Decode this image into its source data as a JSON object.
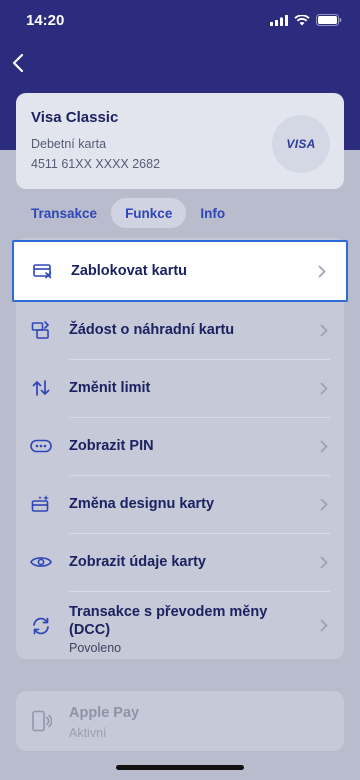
{
  "status_bar": {
    "time": "14:20"
  },
  "card": {
    "name": "Visa Classic",
    "type": "Debetní karta",
    "number": "4511 61XX XXXX 2682",
    "brand": "VISA"
  },
  "tabs": [
    {
      "label": "Transakce"
    },
    {
      "label": "Funkce"
    },
    {
      "label": "Info"
    }
  ],
  "menu": {
    "items": [
      {
        "label": "Zablokovat kartu",
        "icon": "card-block-icon"
      },
      {
        "label": "Žádost o náhradní kartu",
        "icon": "card-replace-icon"
      },
      {
        "label": "Změnit limit",
        "icon": "arrows-updown-icon"
      },
      {
        "label": "Zobrazit PIN",
        "icon": "pin-dots-icon"
      },
      {
        "label": "Změna designu karty",
        "icon": "card-design-icon"
      },
      {
        "label": "Zobrazit údaje karty",
        "icon": "eye-icon"
      },
      {
        "label": "Transakce s převodem měny (DCC)",
        "sub": "Povoleno",
        "icon": "refresh-icon"
      }
    ]
  },
  "apple_pay": {
    "title": "Apple Pay",
    "status": "Aktivní",
    "icon": "phone-pay-icon"
  },
  "colors": {
    "primary": "#2b2c7e",
    "accent": "#2f46b6",
    "highlight_border": "#2f6bd8"
  }
}
